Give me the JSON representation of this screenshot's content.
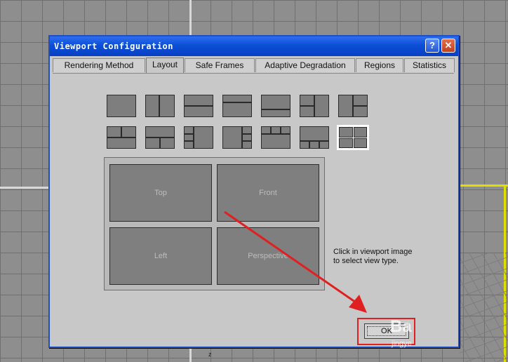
{
  "window": {
    "title": "Viewport Configuration",
    "help_label": "?",
    "close_label": "✕"
  },
  "tabs": [
    {
      "label": "Rendering Method"
    },
    {
      "label": "Layout",
      "active": true
    },
    {
      "label": "Safe Frames"
    },
    {
      "label": "Adaptive Degradation"
    },
    {
      "label": "Regions"
    },
    {
      "label": "Statistics"
    }
  ],
  "preview": {
    "viewports": [
      "Top",
      "Front",
      "Left",
      "Perspective"
    ]
  },
  "hint": "Click in viewport image to select view type.",
  "ok_label": "OK",
  "background": {
    "axis_label": "z"
  },
  "watermark": {
    "main": "Ba",
    "sub": "jingye"
  },
  "colors": {
    "title_bar": "#0b4fd6",
    "annotation": "#e02020",
    "viewport_fill": "#7f7f7f"
  }
}
